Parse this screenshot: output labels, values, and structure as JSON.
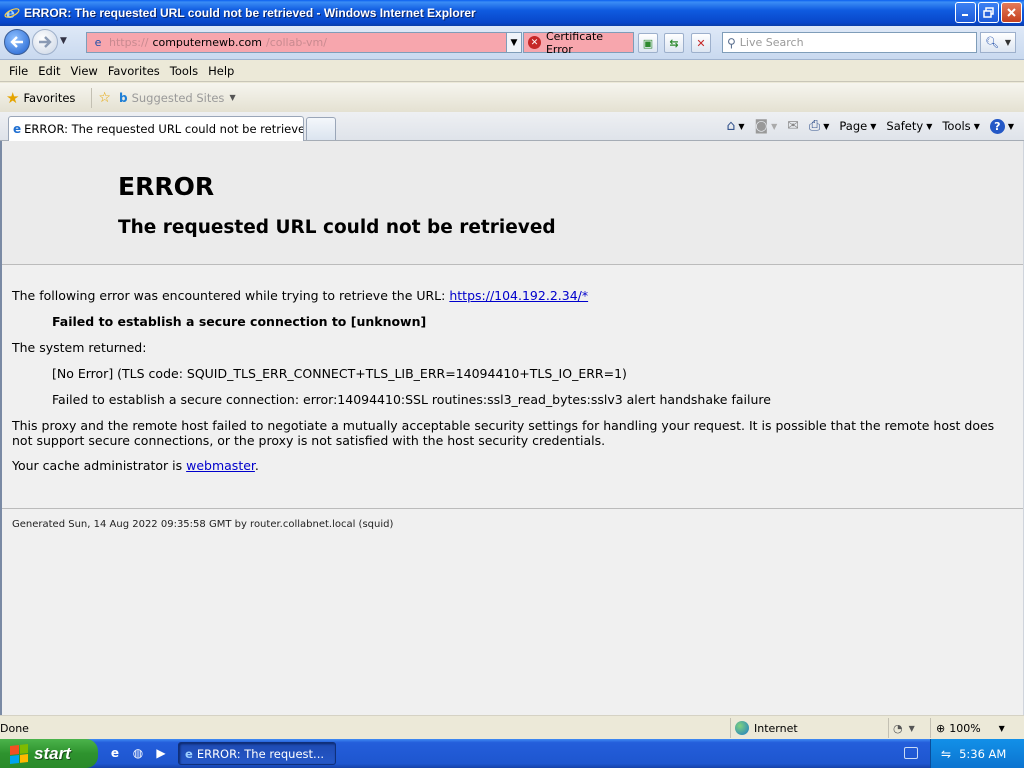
{
  "window": {
    "title": "ERROR: The requested URL could not be retrieved - Windows Internet Explorer"
  },
  "address": {
    "url_prefix": "https://",
    "url_host": "computernewb.com",
    "url_suffix": "/collab-vm/",
    "cert_error_label": "Certificate Error",
    "bar_color": "#f7a6ad"
  },
  "search": {
    "placeholder": "Live Search"
  },
  "menu": {
    "items": [
      "File",
      "Edit",
      "View",
      "Favorites",
      "Tools",
      "Help"
    ]
  },
  "favorites_bar": {
    "favorites_label": "Favorites",
    "suggested_sites_label": "Suggested Sites"
  },
  "tabs": {
    "active_tab_label": "ERROR: The requested URL could not be retrieved"
  },
  "command_bar": {
    "page_label": "Page",
    "safety_label": "Safety",
    "tools_label": "Tools"
  },
  "page": {
    "h1": "ERROR",
    "h2": "The requested URL could not be retrieved",
    "intro_text": "The following error was encountered while trying to retrieve the URL: ",
    "intro_link": "https://104.192.2.34/*",
    "failed_msg": "Failed to establish a secure connection to [unknown]",
    "system_returned": "The system returned:",
    "no_error_line": "[No Error] (TLS code: SQUID_TLS_ERR_CONNECT+TLS_LIB_ERR=14094410+TLS_IO_ERR=1)",
    "ssl_error_line": "Failed to establish a secure connection: error:14094410:SSL routines:ssl3_read_bytes:sslv3 alert handshake failure",
    "explanation": "This proxy and the remote host failed to negotiate a mutually acceptable security settings for handling your request. It is possible that the remote host does not support secure connections, or the proxy is not satisfied with the host security credentials.",
    "admin_prefix": "Your cache administrator is ",
    "admin_link": "webmaster",
    "admin_suffix": ".",
    "footer": "Generated Sun, 14 Aug 2022 09:35:58 GMT by router.collabnet.local (squid)"
  },
  "status_bar": {
    "status_text": "Done",
    "zone_label": "Internet",
    "zoom_label": "100%"
  },
  "taskbar": {
    "start_label": "start",
    "task_item_label": "ERROR: The request...",
    "clock": "5:36 AM"
  }
}
